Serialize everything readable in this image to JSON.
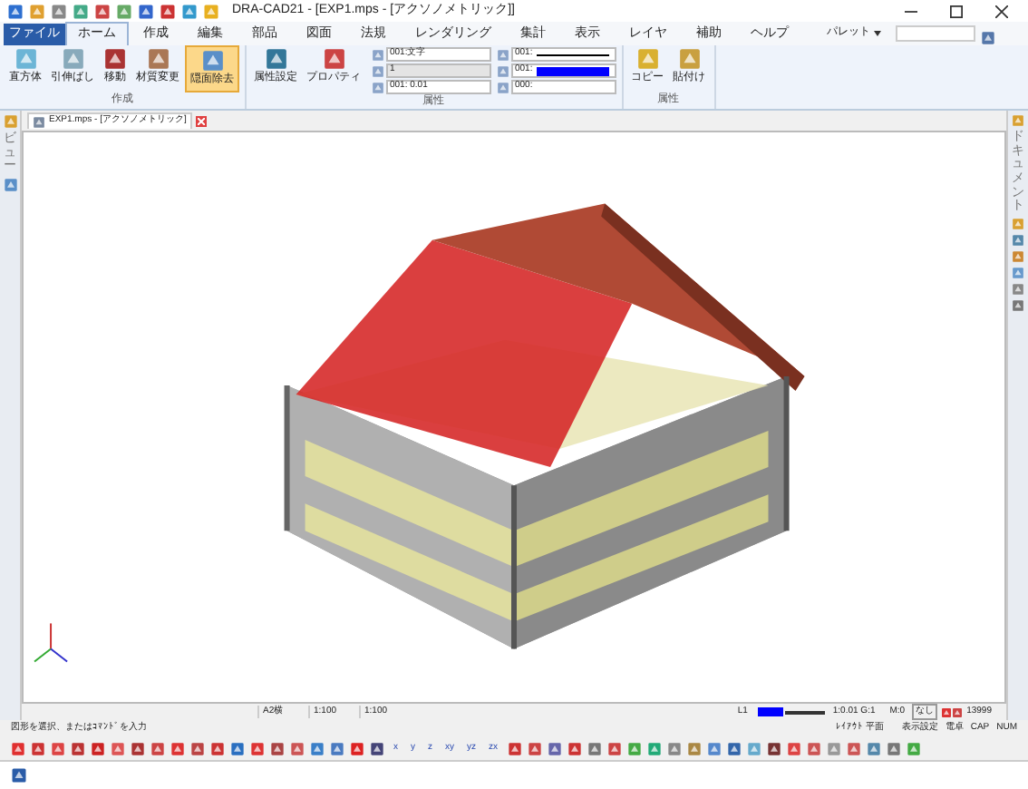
{
  "window": {
    "title": "DRA-CAD21 - [EXP1.mps - [アクソノメトリック]]"
  },
  "menu": [
    {
      "label": "ファイル",
      "kind": "file",
      "selected": false
    },
    {
      "label": "ホーム",
      "kind": "tab",
      "selected": true
    },
    {
      "label": "作成",
      "kind": "tab",
      "selected": false
    },
    {
      "label": "編集",
      "kind": "tab",
      "selected": false
    },
    {
      "label": "部品",
      "kind": "tab",
      "selected": false
    },
    {
      "label": "図面",
      "kind": "tab",
      "selected": false
    },
    {
      "label": "法規",
      "kind": "tab",
      "selected": false
    },
    {
      "label": "レンダリング",
      "kind": "tab",
      "selected": false
    },
    {
      "label": "集計",
      "kind": "tab",
      "selected": false
    },
    {
      "label": "表示",
      "kind": "tab",
      "selected": false
    },
    {
      "label": "レイヤ",
      "kind": "tab",
      "selected": false
    },
    {
      "label": "補助",
      "kind": "tab",
      "selected": false
    },
    {
      "label": "ヘルプ",
      "kind": "tab",
      "selected": false
    }
  ],
  "palette": {
    "label": "パレット"
  },
  "ribbon": {
    "groups": [
      {
        "label": "作成",
        "buttons": [
          {
            "label": "直方体",
            "selected": false
          },
          {
            "label": "引伸ばし",
            "selected": false
          },
          {
            "label": "移動",
            "selected": false
          },
          {
            "label": "材質変更",
            "selected": false
          },
          {
            "label": "隠面除去",
            "selected": true
          }
        ]
      },
      {
        "label": "属性",
        "buttons": [
          {
            "label": "属性設定",
            "selected": false
          },
          {
            "label": "プロパティ",
            "selected": false
          }
        ],
        "fields": [
          {
            "value": "001:文字"
          },
          {
            "value": "001:",
            "kind": "line"
          },
          {
            "value": "1",
            "disabled": true
          },
          {
            "value": "001:",
            "color": "#0000ff"
          },
          {
            "value": "001: 0.01"
          },
          {
            "value": "000:"
          }
        ]
      },
      {
        "label": "属性",
        "buttons": [
          {
            "label": "コピー",
            "selected": false
          },
          {
            "label": "貼付け",
            "selected": false
          }
        ]
      }
    ]
  },
  "document_tab": {
    "title": "EXP1.mps - [アクソノメトリック]"
  },
  "left_panel": {
    "label": "ビュー"
  },
  "right_panel": {
    "label": "ドキュメント"
  },
  "status_bar": {
    "cells": [
      "A2横",
      "1:100",
      "1:100"
    ],
    "layer": "L1",
    "scale": "1:0.01 G:1",
    "mode": "M:0",
    "none": "なし",
    "count": "13999",
    "layout": "ﾚｲｱｳﾄ 平面",
    "flags": [
      "表示設定",
      "電卓",
      "CAP",
      "NUM"
    ]
  },
  "command_line": {
    "prompt": "図形を選択、またはｺﾏﾝﾄﾞを入力"
  },
  "toolbar": {
    "axis_buttons": [
      "x",
      "y",
      "z",
      "xy",
      "yz",
      "zx"
    ]
  }
}
